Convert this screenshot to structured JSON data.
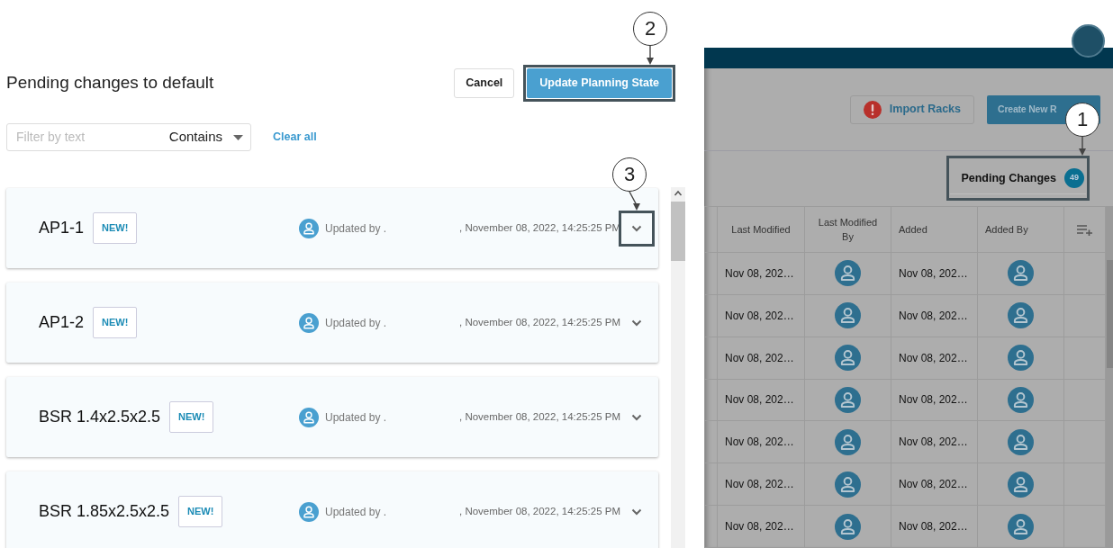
{
  "panel": {
    "title": "Pending changes to default",
    "buttons": [
      {
        "label": "Cancel",
        "kind": "secondary"
      },
      {
        "label": "Update Planning State",
        "kind": "primary"
      }
    ],
    "filter": {
      "placeholder": "Filter by text",
      "operator": "Contains"
    },
    "clear_link": "Clear all",
    "changes": [
      {
        "name": "AP1-1",
        "badge": "NEW!",
        "updated_by": "Updated by .",
        "timestamp": ", November 08, 2022, 14:25:25 PM"
      },
      {
        "name": "AP1-2",
        "badge": "NEW!",
        "updated_by": "Updated by .",
        "timestamp": ", November 08, 2022, 14:25:25 PM"
      },
      {
        "name": "BSR 1.4x2.5x2.5",
        "badge": "NEW!",
        "updated_by": "Updated by .",
        "timestamp": ", November 08, 2022, 14:25:25 PM"
      },
      {
        "name": "BSR 1.85x2.5x2.5",
        "badge": "NEW!",
        "updated_by": "Updated by .",
        "timestamp": ", November 08, 2022, 14:25:25 PM"
      }
    ]
  },
  "background_app": {
    "toolbar_buttons": [
      {
        "label": "Import Racks",
        "kind": "import"
      },
      {
        "label": "Create New R",
        "kind": "create"
      }
    ],
    "pending_tab": {
      "label": "Pending Changes",
      "count": "49"
    },
    "table": {
      "columns": [
        "Last Modified",
        "Last Modified By",
        "Added",
        "Added By"
      ],
      "rows": [
        {
          "last_modified": "Nov 08, 202…",
          "added": "Nov 08, 202…"
        },
        {
          "last_modified": "Nov 08, 202…",
          "added": "Nov 08, 202…"
        },
        {
          "last_modified": "Nov 08, 202…",
          "added": "Nov 08, 202…"
        },
        {
          "last_modified": "Nov 08, 202…",
          "added": "Nov 08, 202…"
        },
        {
          "last_modified": "Nov 08, 202…",
          "added": "Nov 08, 202…"
        },
        {
          "last_modified": "Nov 08, 202…",
          "added": "Nov 08, 202…"
        },
        {
          "last_modified": "Nov 08, 202…",
          "added": "Nov 08, 202…"
        }
      ]
    }
  },
  "callouts": [
    {
      "label": "1"
    },
    {
      "label": "2"
    },
    {
      "label": "3"
    }
  ]
}
